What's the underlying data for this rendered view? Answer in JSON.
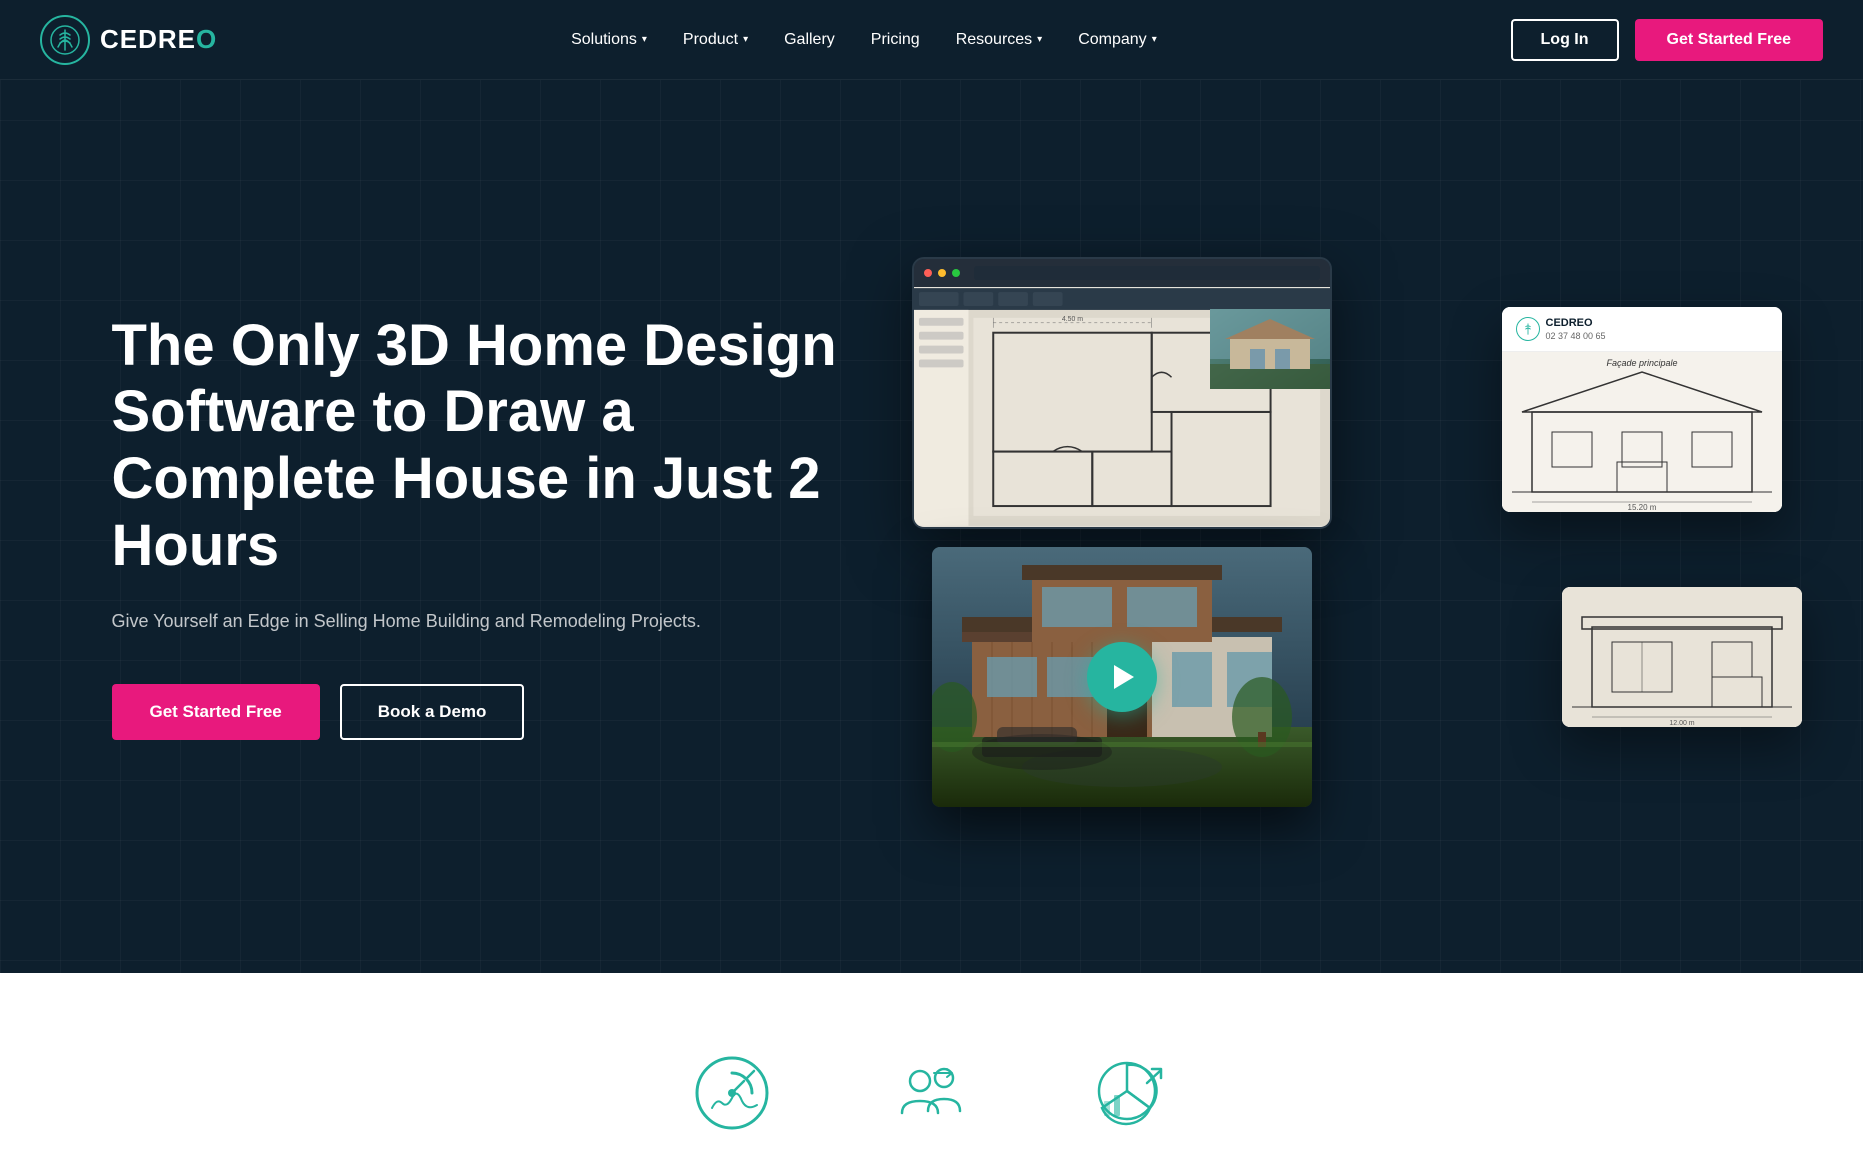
{
  "brand": {
    "name_part1": "CEDREO",
    "name_accent": "O",
    "logo_alt": "Cedreo logo"
  },
  "navbar": {
    "links": [
      {
        "label": "Solutions",
        "has_dropdown": true,
        "id": "solutions"
      },
      {
        "label": "Product",
        "has_dropdown": true,
        "id": "product"
      },
      {
        "label": "Gallery",
        "has_dropdown": false,
        "id": "gallery"
      },
      {
        "label": "Pricing",
        "has_dropdown": false,
        "id": "pricing"
      },
      {
        "label": "Resources",
        "has_dropdown": true,
        "id": "resources"
      },
      {
        "label": "Company",
        "has_dropdown": true,
        "id": "company"
      }
    ],
    "login_label": "Log In",
    "cta_label": "Get Started Free"
  },
  "hero": {
    "title": "The Only 3D Home Design Software to Draw a Complete House in Just 2 Hours",
    "subtitle": "Give Yourself an Edge in Selling Home Building and Remodeling Projects.",
    "cta_primary": "Get Started Free",
    "cta_secondary": "Book a Demo"
  },
  "colors": {
    "teal": "#26b5a0",
    "pink": "#e8197d",
    "dark_bg": "#0d1f2d",
    "white": "#ffffff"
  },
  "bottom_icons": [
    {
      "id": "icon1",
      "label": "Speed"
    },
    {
      "id": "icon2",
      "label": "Collaboration"
    },
    {
      "id": "icon3",
      "label": "Analytics"
    }
  ]
}
